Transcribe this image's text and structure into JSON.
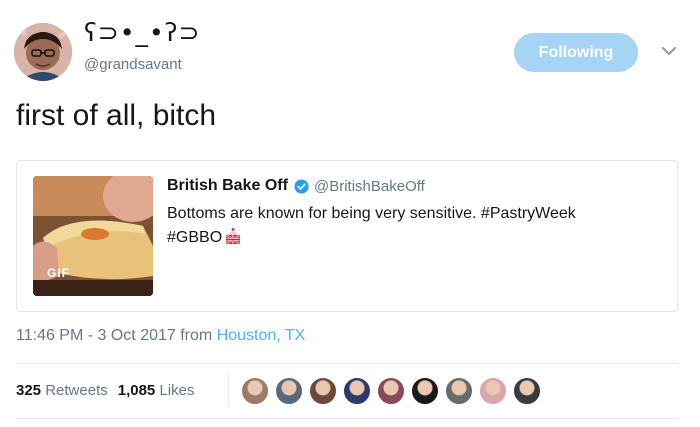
{
  "author": {
    "name": "ʕ⊃•_•ʔ⊃",
    "handle": "@grandsavant",
    "avatar_icon": "user-avatar-selfie"
  },
  "follow_button": {
    "label": "Following",
    "color": "#a6d4f5"
  },
  "tweet": {
    "text": "first of all, bitch"
  },
  "quoted_tweet": {
    "name": "British Bake Off",
    "handle": "@BritishBakeOff",
    "verified": true,
    "text_line1": "Bottoms are known for being very sensitive. #PastryWeek",
    "text_line2": "#GBBO",
    "media_badge": "GIF",
    "emoji_icon": "gbbo-flag-cake-emoji"
  },
  "meta": {
    "time": "11:46 PM - 3 Oct 2017 from ",
    "location": "Houston, TX"
  },
  "stats": {
    "retweets_count": "325",
    "retweets_label": "Retweets",
    "likes_count": "1,085",
    "likes_label": "Likes",
    "liker_avatar_colors": [
      "#9a7a6a",
      "#5a6a7a",
      "#6b4a3a",
      "#2a3a6a",
      "#8a4a5a",
      "#1a1a1a",
      "#6a6a6a",
      "#d9a6b0",
      "#3a3a3a"
    ]
  },
  "colors": {
    "link": "#4ab3f4",
    "muted": "#657786",
    "text": "#14171a",
    "verified": "#1da1f2"
  }
}
